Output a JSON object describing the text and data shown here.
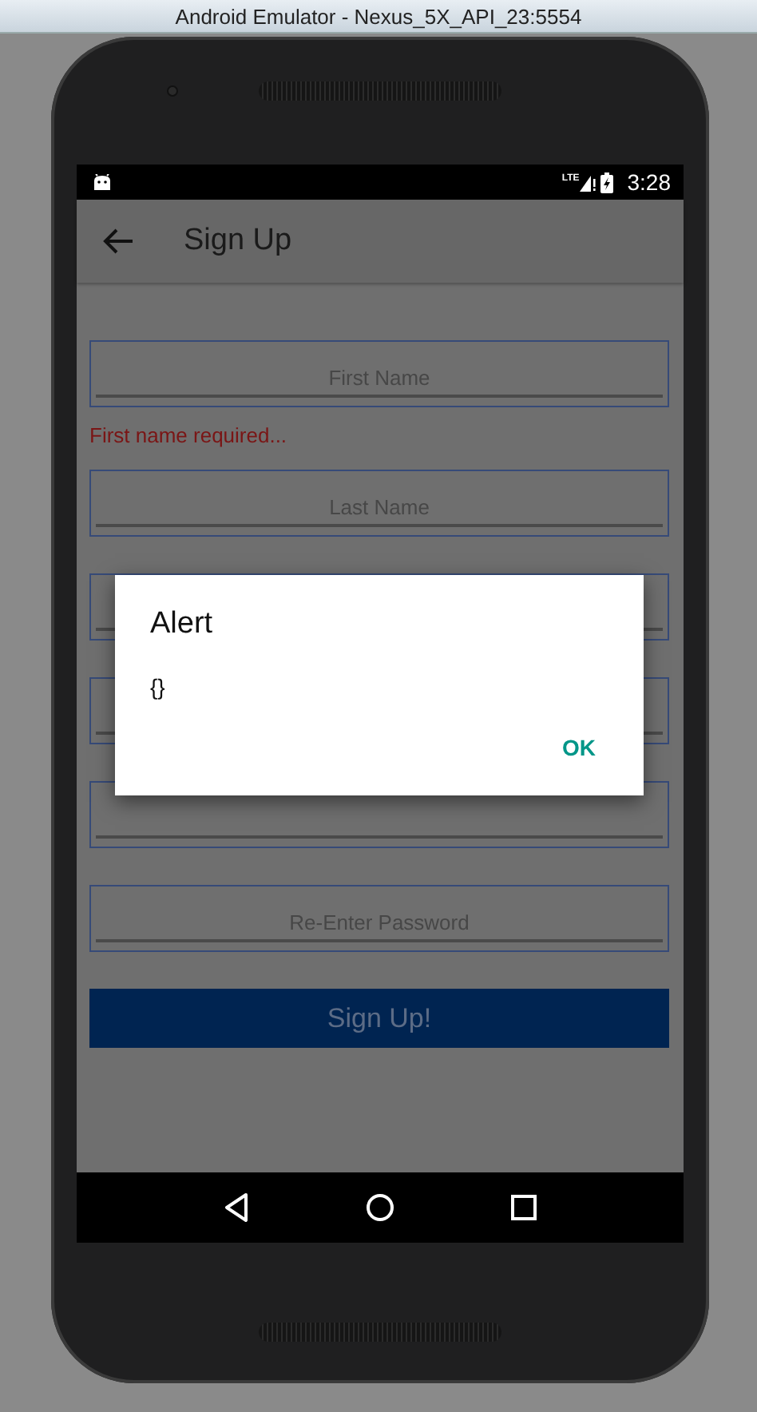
{
  "window": {
    "title": "Android Emulator - Nexus_5X_API_23:5554"
  },
  "status_bar": {
    "network": "LTE",
    "time": "3:28"
  },
  "toolbar": {
    "title": "Sign Up"
  },
  "form": {
    "fields": [
      {
        "kind": "text",
        "placeholder": "First Name",
        "error": "First name required..."
      },
      {
        "kind": "text",
        "placeholder": "Last Name"
      },
      {
        "kind": "text"
      },
      {
        "kind": "text"
      },
      {
        "kind": "text"
      },
      {
        "kind": "text",
        "placeholder": "Re-Enter Password"
      }
    ],
    "submit": "Sign Up!"
  },
  "dialog": {
    "title": "Alert",
    "message": "{}",
    "button": "OK"
  }
}
